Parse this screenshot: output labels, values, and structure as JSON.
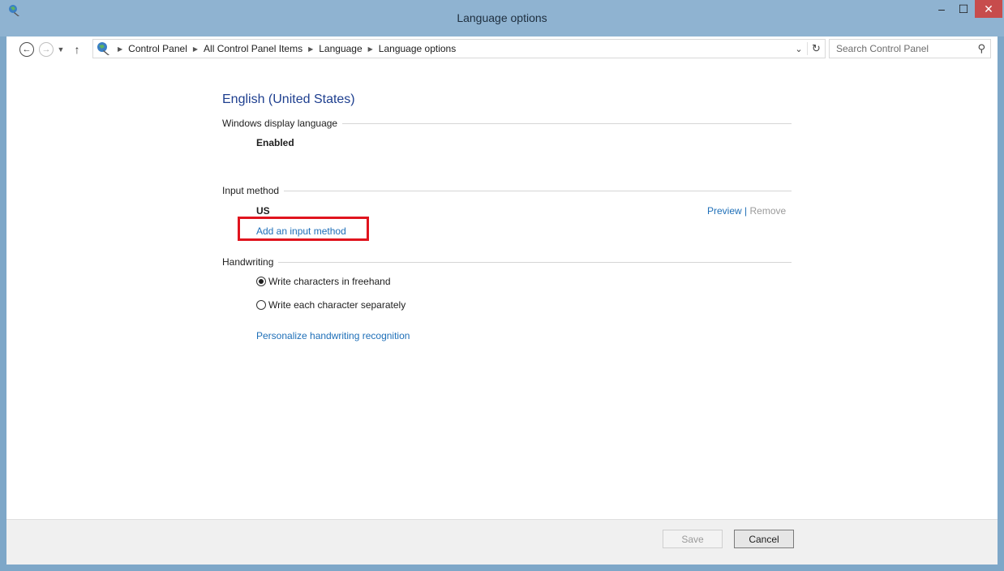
{
  "window": {
    "title": "Language options",
    "controls": {
      "minimize": "–",
      "maximize": "☐",
      "close": "✕"
    }
  },
  "nav": {
    "back_icon": "back-arrow-icon",
    "forward_icon": "forward-arrow-icon",
    "up_icon": "up-arrow-icon",
    "breadcrumbs": [
      "Control Panel",
      "All Control Panel Items",
      "Language",
      "Language options"
    ],
    "search_placeholder": "Search Control Panel"
  },
  "content": {
    "language_title": "English (United States)",
    "display_section": {
      "label": "Windows display language",
      "status": "Enabled"
    },
    "input_section": {
      "label": "Input method",
      "method_name": "US",
      "preview_link": "Preview",
      "separator": "|",
      "remove_link": "Remove",
      "add_link": "Add an input method"
    },
    "handwriting_section": {
      "label": "Handwriting",
      "options": [
        {
          "label": "Write characters in freehand",
          "checked": true
        },
        {
          "label": "Write each character separately",
          "checked": false
        }
      ],
      "personalize_link": "Personalize handwriting recognition"
    }
  },
  "footer": {
    "save_label": "Save",
    "cancel_label": "Cancel"
  },
  "colors": {
    "titlebar": "#8fb3d1",
    "link": "#1e6fb8",
    "heading": "#1e3f8f",
    "highlight": "#e0141e",
    "close_button": "#c74c4c"
  }
}
